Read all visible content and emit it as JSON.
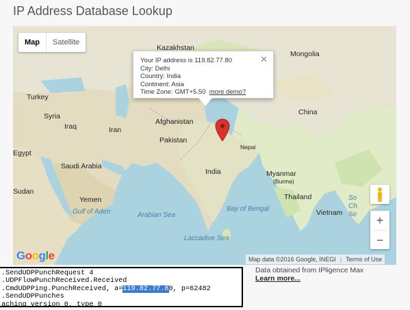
{
  "page": {
    "title": "IP Address Database Lookup"
  },
  "map": {
    "type_control": {
      "map_label": "Map",
      "satellite_label": "Satellite",
      "selected": "Map"
    },
    "infowindow": {
      "ip_line": "Your IP address is 119.82.77.80",
      "city_line": "City: Delhi",
      "country_line": "Country: India",
      "continent_line": "Continent: Asia",
      "timezone_line": "Time Zone: GMT+5.50",
      "more_demo_link": "more demo?",
      "close_symbol": "✕"
    },
    "labels": {
      "kazakhstan": "Kazakhstan",
      "mongolia": "Mongolia",
      "turkey": "Turkey",
      "syria": "Syria",
      "iraq": "Iraq",
      "iran": "Iran",
      "afghanistan": "Afghanistan",
      "pakistan": "Pakistan",
      "china": "China",
      "egypt": "Egypt",
      "saudi_arabia": "Saudi Arabia",
      "nepal": "Nepal",
      "india": "India",
      "myanmar": "Myanmar",
      "myanmar_sub": "(Burma)",
      "thailand": "Thailand",
      "yemen": "Yemen",
      "sudan": "Sudan",
      "vietnam": "Vietnam",
      "gulf_of_aden": "Gulf of Aden",
      "arabian_sea": "Arabian Sea",
      "bay_of_bengal": "Bay of Bengal",
      "laccadive_sea": "Laccadive Sea",
      "sea_right_1": "So",
      "sea_right_2": "Ch",
      "sea_right_3": "Se"
    },
    "zoom_in": "+",
    "zoom_out": "−",
    "google_logo": {
      "g1": "G",
      "o1": "o",
      "o2": "o",
      "g2": "g",
      "l": "l",
      "e": "e"
    },
    "attribution": {
      "data": "Map data ©2016 Google, INEGI",
      "terms": "Terms of Use"
    },
    "marker_color": "#d9342b"
  },
  "footer": {
    "obtained_text": "Data obtained from IPligence Max",
    "learn_more": "Learn more..."
  },
  "console": {
    "line1": ".SendUDPPunchRequest 4",
    "line2": ".UDPFlowPunchReceived.Received",
    "line3_pre": ".CmdUDPPing.PunchReceived, a=",
    "line3_hl": "119.82.77.8",
    "line3_post": "0, p=62482",
    "line4": ".SendUDPPunches",
    "line5": "aching version 0, type 0"
  }
}
